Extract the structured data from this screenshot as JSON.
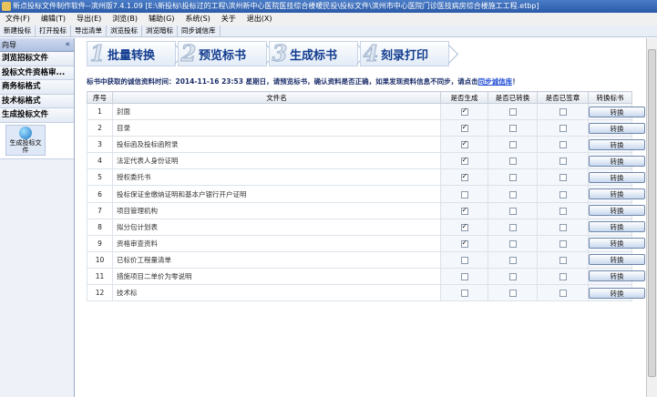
{
  "window": {
    "title": "新点投标文件制作软件--滨州版7.4.1.09    [E:\\新投标\\投标过的工程\\滨州新中心医院医技综合楼暖民投\\投标文件\\滨州市中心医院门诊医技病房综合楼施工工程.etbp]"
  },
  "menu": [
    "文件(F)",
    "编辑(T)",
    "导出(E)",
    "浏览(B)",
    "辅助(G)",
    "系统(S)",
    "关于",
    "退出(X)"
  ],
  "toolbar": [
    "新建投标",
    "打开投标",
    "导出清单",
    "浏览投标",
    "浏览暗标",
    "同步诚信库"
  ],
  "sidebar": {
    "header": "向导",
    "collapse_glyph": "«",
    "items": [
      "浏览招标文件",
      "投标文件资格审...",
      "商务标格式",
      "技术标格式",
      "生成投标文件"
    ],
    "tool_label": "生成投标文件"
  },
  "steps": [
    {
      "num": "1",
      "label": "批量转换"
    },
    {
      "num": "2",
      "label": "预览标书"
    },
    {
      "num": "3",
      "label": "生成标书"
    },
    {
      "num": "4",
      "label": "刻录打印"
    }
  ],
  "notice": {
    "text": "标书中获取的诚信资料时间：2014-11-16 23:53 星期日，请预览标书，确认资料是否正确，如果发现资料信息不同步，请点击",
    "link": "同步诚信库",
    "suffix": "！"
  },
  "table": {
    "headers": [
      "序号",
      "文件名",
      "是否生成",
      "是否已转换",
      "是否已签章",
      "转换标书"
    ],
    "button_label": "转换",
    "rows": [
      {
        "no": "1",
        "name": "封面",
        "generated": true,
        "converted": false,
        "signed": false
      },
      {
        "no": "2",
        "name": "目录",
        "generated": true,
        "converted": false,
        "signed": false
      },
      {
        "no": "3",
        "name": "投标函及投标函附录",
        "generated": true,
        "converted": false,
        "signed": false
      },
      {
        "no": "4",
        "name": "法定代表人身份证明",
        "generated": true,
        "converted": false,
        "signed": false
      },
      {
        "no": "5",
        "name": "授权委托书",
        "generated": true,
        "converted": false,
        "signed": false
      },
      {
        "no": "6",
        "name": "投标保证金缴纳证明和基本户银行开户证明",
        "generated": false,
        "converted": false,
        "signed": false
      },
      {
        "no": "7",
        "name": "项目管理机构",
        "generated": true,
        "converted": false,
        "signed": false
      },
      {
        "no": "8",
        "name": "拟分包计划表",
        "generated": true,
        "converted": false,
        "signed": false
      },
      {
        "no": "9",
        "name": "资格审查资料",
        "generated": true,
        "converted": false,
        "signed": false
      },
      {
        "no": "10",
        "name": "已标价工程量清单",
        "generated": false,
        "converted": false,
        "signed": false
      },
      {
        "no": "11",
        "name": "措施项目二单价为零说明",
        "generated": false,
        "converted": false,
        "signed": false
      },
      {
        "no": "12",
        "name": "技术标",
        "generated": false,
        "converted": false,
        "signed": false
      }
    ]
  }
}
